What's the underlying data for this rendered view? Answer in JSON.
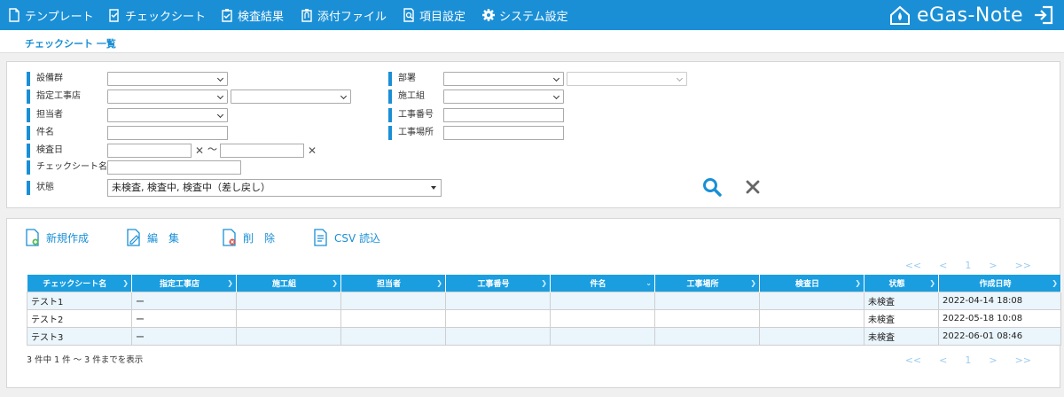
{
  "nav": {
    "template": "テンプレート",
    "checksheet": "チェックシート",
    "inspection_result": "検査結果",
    "attachment": "添付ファイル",
    "item_setting": "項目設定",
    "system_setting": "システム設定"
  },
  "brand": {
    "name": "eGas-Note"
  },
  "page": {
    "title": "チェックシート 一覧"
  },
  "search": {
    "equipment_group": "設備群",
    "designated_contractor": "指定工事店",
    "person_in_charge": "担当者",
    "subject": "件名",
    "inspection_date": "検査日",
    "date_separator": "～",
    "checksheet_name": "チェックシート名",
    "status": "状態",
    "status_value": "未検査, 検査中, 検査中（差し戻し）",
    "department": "部署",
    "construction_group": "施工組",
    "work_number": "工事番号",
    "work_location": "工事場所",
    "clear_mark": "✕"
  },
  "actions": {
    "new": "新規作成",
    "edit": "編　集",
    "delete": "削　除",
    "csv": "CSV 読込"
  },
  "pager": {
    "first": "<<",
    "prev": "<",
    "page": "1",
    "next": ">",
    "last": ">>"
  },
  "table": {
    "headers": [
      "チェックシート名",
      "指定工事店",
      "施工組",
      "担当者",
      "工事番号",
      "件名",
      "工事場所",
      "検査日",
      "状態",
      "作成日時"
    ],
    "rows": [
      [
        "テスト1",
        "ー",
        "",
        "",
        "",
        "",
        "",
        "",
        "未検査",
        "2022-04-14 18:08"
      ],
      [
        "テスト2",
        "ー",
        "",
        "",
        "",
        "",
        "",
        "",
        "未検査",
        "2022-05-18 10:08"
      ],
      [
        "テスト3",
        "ー",
        "",
        "",
        "",
        "",
        "",
        "",
        "未検査",
        "2022-06-01 08:46"
      ]
    ],
    "count_text": "3 件中 1 件 ～ 3 件までを表示"
  },
  "colors": {
    "accent": "#1a8fd6",
    "header": "#1a9ee0",
    "row_alt": "#eaf5fc"
  }
}
